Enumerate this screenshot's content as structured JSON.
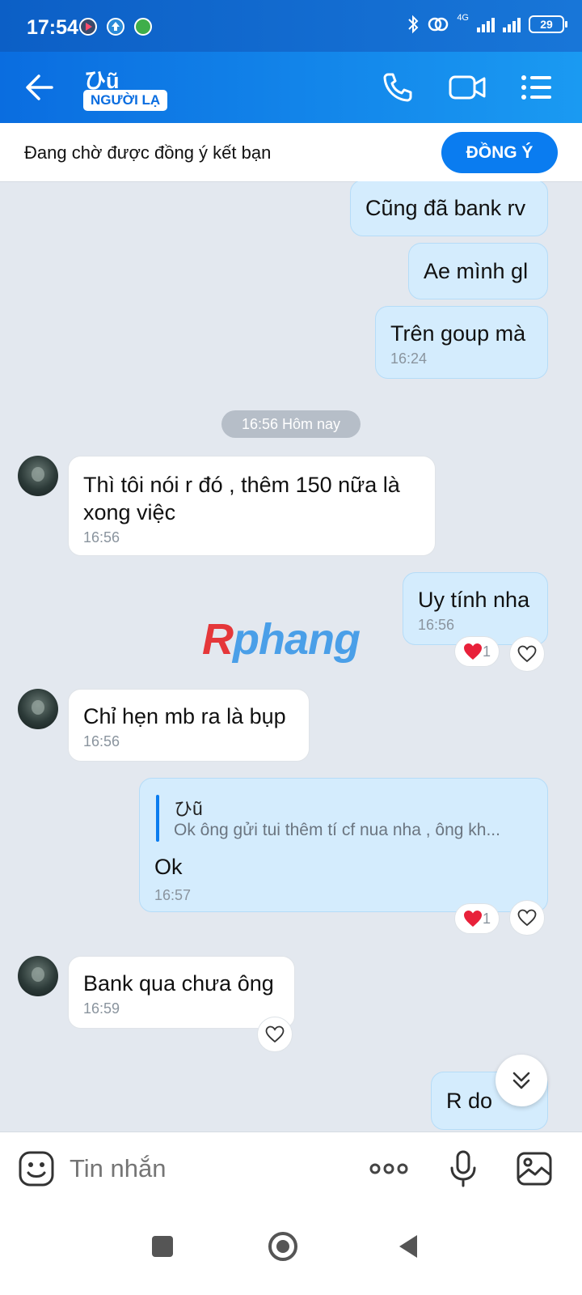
{
  "status_bar": {
    "time": "17:54",
    "network": "4G",
    "battery": "29"
  },
  "header": {
    "contact_name": "ひũ",
    "badge": "NGƯỜI LẠ",
    "icons": [
      "back-icon",
      "phone-icon",
      "video-call-icon",
      "menu-list-icon"
    ]
  },
  "friend_request": {
    "text": "Đang chờ được đồng ý kết bạn",
    "accept_label": "ĐỒNG Ý"
  },
  "date_divider": "16:56 Hôm nay",
  "watermark": {
    "part1": "R",
    "part2": "phang"
  },
  "messages": [
    {
      "text": "Cũng đã bank rv"
    },
    {
      "text": "Ae mình gl"
    },
    {
      "text": "Trên goup mà",
      "time": "16:24"
    },
    {
      "line1": "Thì tôi nói r đó , thêm 150 nữa là",
      "line2": "xong việc",
      "time": "16:56"
    },
    {
      "text": "Uy tính nha",
      "time": "16:56",
      "reaction_count": "1"
    },
    {
      "text": "Chỉ hẹn mb ra là bụp",
      "time": "16:56"
    },
    {
      "quote_author": "ひũ",
      "quote_text": "Ok ông gửi tui thêm tí cf nua nha , ông kh...",
      "text": "Ok",
      "time": "16:57",
      "reaction_count": "1"
    },
    {
      "text": "Bank qua chưa ông",
      "time": "16:59"
    },
    {
      "text": "R do"
    }
  ],
  "input_bar": {
    "placeholder": "Tin nhắn",
    "icons": [
      "sticker-icon",
      "more-icon",
      "microphone-icon",
      "image-icon"
    ]
  },
  "colors": {
    "primary": "#0a7cf0",
    "header_gradient_start": "#0a6de0",
    "outgoing_bubble": "#d4ecfd",
    "incoming_bubble": "#ffffff",
    "heart": "#e8213a"
  }
}
